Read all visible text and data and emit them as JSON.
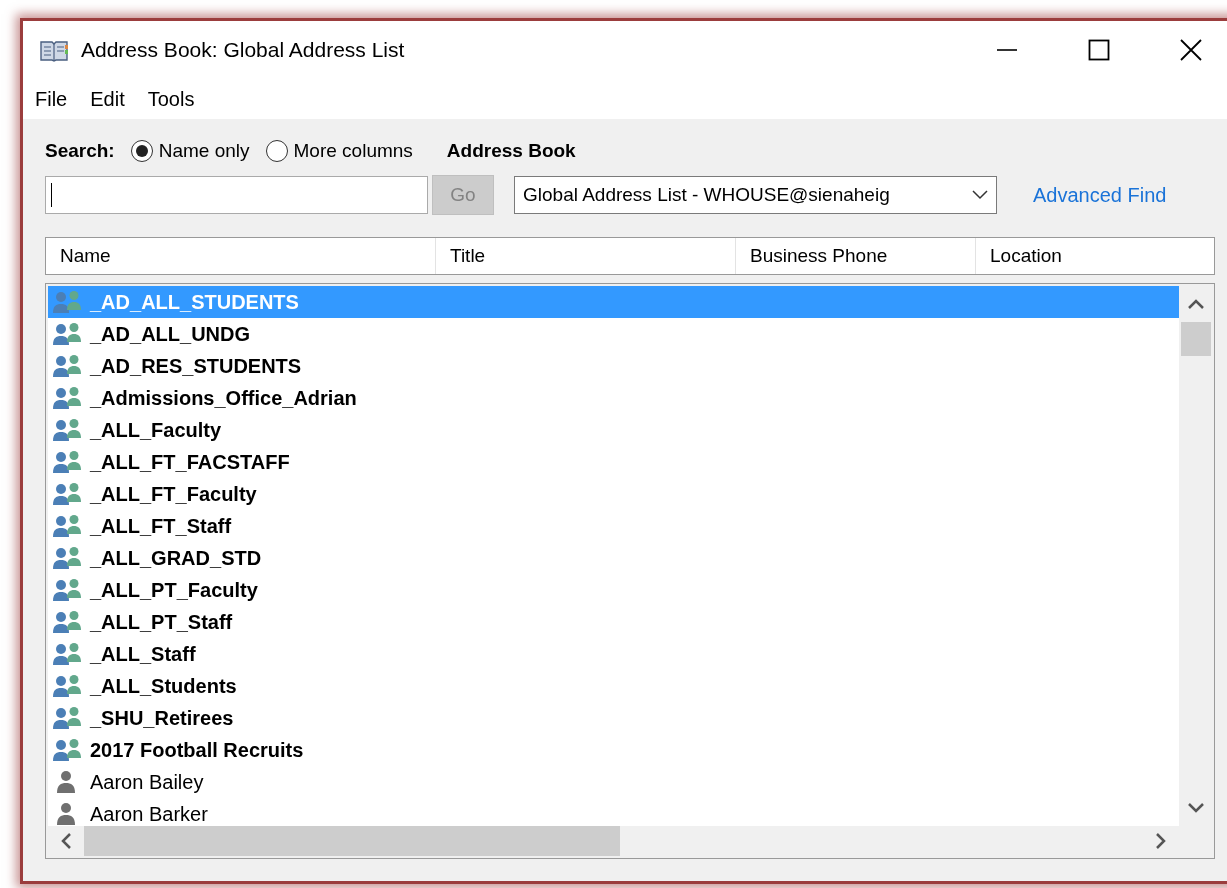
{
  "window": {
    "title": "Address Book: Global Address List"
  },
  "menu": [
    {
      "label": "File"
    },
    {
      "label": "Edit"
    },
    {
      "label": "Tools"
    }
  ],
  "search": {
    "label": "Search:",
    "options": [
      {
        "label": "Name only",
        "selected": true
      },
      {
        "label": "More columns",
        "selected": false
      }
    ],
    "go_button": {
      "label": "Go",
      "disabled": true
    }
  },
  "address_book": {
    "label": "Address Book",
    "value": "Global Address List - WHOUSE@sienaheig"
  },
  "advanced_find": "Advanced Find",
  "table": {
    "columns": [
      "Name",
      "Title",
      "Business Phone",
      "Location"
    ],
    "rows": [
      {
        "name": "_AD_ALL_STUDENTS",
        "kind": "group",
        "selected": true
      },
      {
        "name": "_AD_ALL_UNDG",
        "kind": "group",
        "selected": false
      },
      {
        "name": "_AD_RES_STUDENTS",
        "kind": "group",
        "selected": false
      },
      {
        "name": "_Admissions_Office_Adrian",
        "kind": "group",
        "selected": false
      },
      {
        "name": "_ALL_Faculty",
        "kind": "group",
        "selected": false
      },
      {
        "name": "_ALL_FT_FACSTAFF",
        "kind": "group",
        "selected": false
      },
      {
        "name": "_ALL_FT_Faculty",
        "kind": "group",
        "selected": false
      },
      {
        "name": "_ALL_FT_Staff",
        "kind": "group",
        "selected": false
      },
      {
        "name": "_ALL_GRAD_STD",
        "kind": "group",
        "selected": false
      },
      {
        "name": "_ALL_PT_Faculty",
        "kind": "group",
        "selected": false
      },
      {
        "name": "_ALL_PT_Staff",
        "kind": "group",
        "selected": false
      },
      {
        "name": "_ALL_Staff",
        "kind": "group",
        "selected": false
      },
      {
        "name": "_ALL_Students",
        "kind": "group",
        "selected": false
      },
      {
        "name": "_SHU_Retirees",
        "kind": "group",
        "selected": false
      },
      {
        "name": "2017 Football Recruits",
        "kind": "group",
        "selected": false
      },
      {
        "name": "Aaron Bailey",
        "kind": "person",
        "selected": false
      },
      {
        "name": "Aaron Barker",
        "kind": "person",
        "selected": false
      }
    ]
  }
}
